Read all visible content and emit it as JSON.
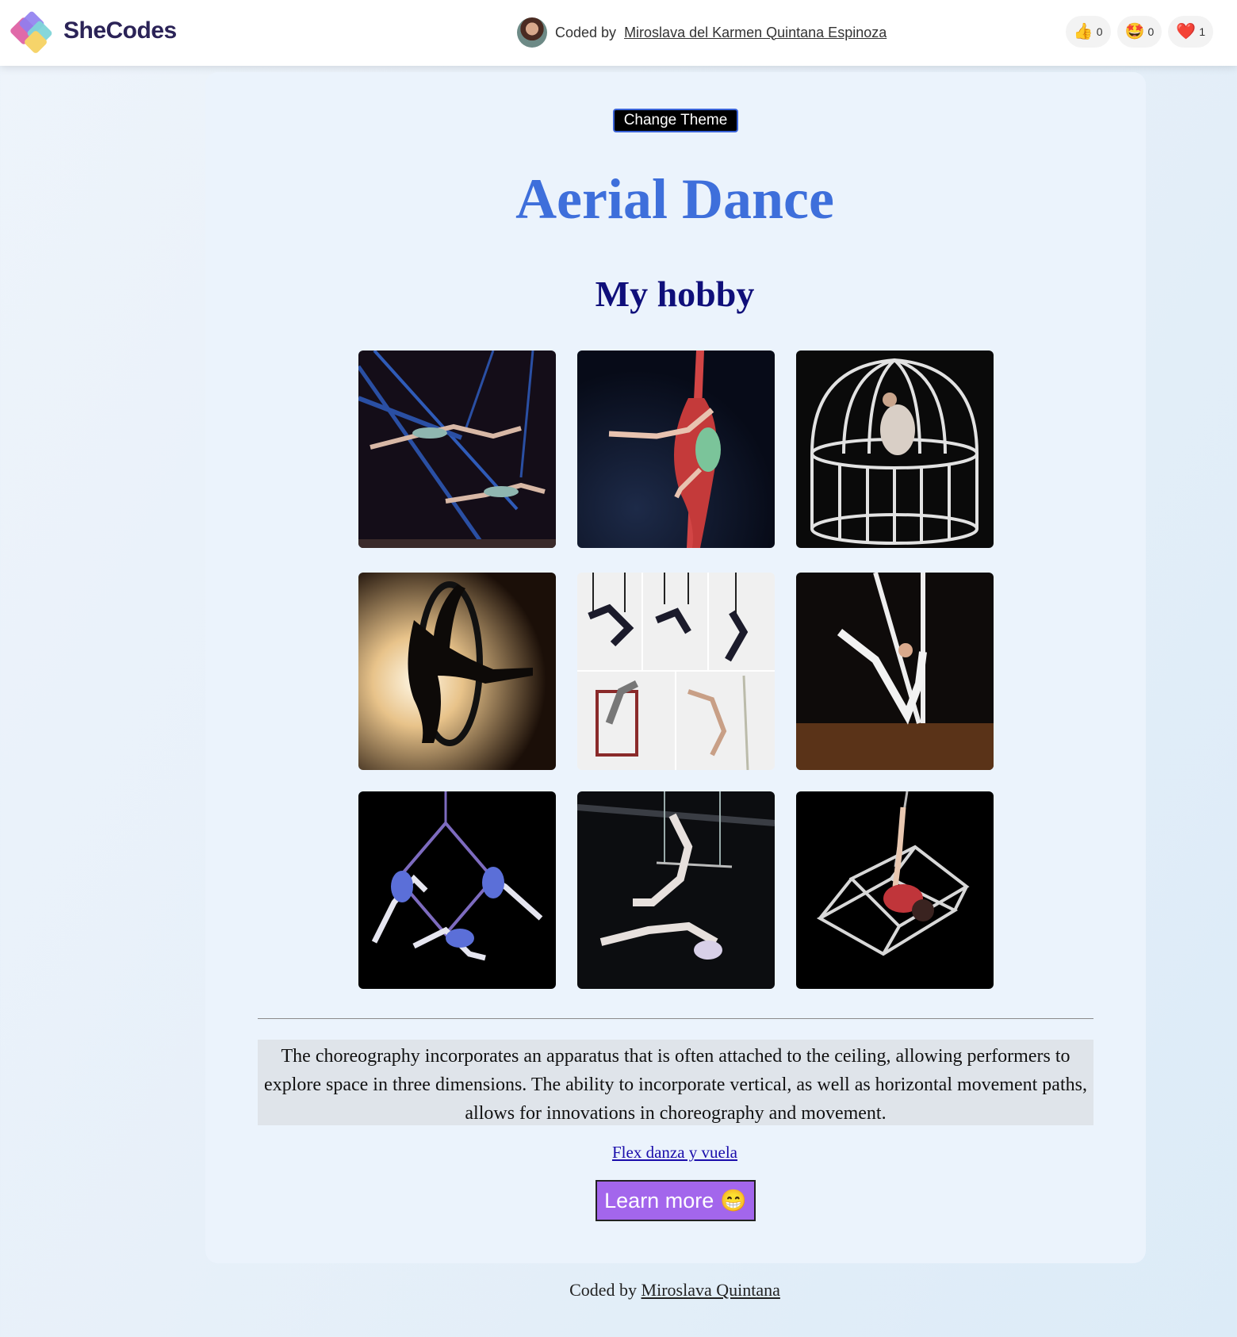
{
  "topbar": {
    "brand": "SheCodes",
    "author_prefix": "Coded by",
    "author_name": "Miroslava del Karmen Quintana Espinoza",
    "reactions": [
      {
        "icon": "thumbs-up-icon",
        "emoji": "👍",
        "count": "0"
      },
      {
        "icon": "star-struck-icon",
        "emoji": "🤩",
        "count": "0"
      },
      {
        "icon": "heart-icon",
        "emoji": "❤️",
        "count": "1"
      }
    ]
  },
  "main": {
    "theme_button": "Change Theme",
    "title": "Aerial Dance",
    "subtitle": "My hobby",
    "photos": [
      {
        "name": "aerial-silks-duo-photo",
        "icon": "photo-icon"
      },
      {
        "name": "red-silks-photo",
        "icon": "photo-icon"
      },
      {
        "name": "birdcage-photo",
        "icon": "photo-icon"
      },
      {
        "name": "aerial-hoop-silhouette-photo",
        "icon": "photo-icon"
      },
      {
        "name": "trapeze-collage-photo",
        "icon": "photo-icon"
      },
      {
        "name": "white-silks-photo",
        "icon": "photo-icon"
      },
      {
        "name": "trio-apparatus-photo",
        "icon": "photo-icon"
      },
      {
        "name": "trapeze-duo-photo",
        "icon": "photo-icon"
      },
      {
        "name": "cube-apparatus-photo",
        "icon": "photo-icon"
      }
    ],
    "description": "The choreography incorporates an apparatus that is often attached to the ceiling, allowing performers to explore space in three dimensions. The ability to incorporate vertical, as well as horizontal movement paths, allows for innovations in choreography and movement.",
    "link": "Flex danza y vuela",
    "learn_button": "Learn more",
    "learn_emoji": "😁"
  },
  "footer": {
    "prefix": "Coded by",
    "name": "Miroslava Quintana"
  },
  "colors": {
    "title": "#3e6fdb",
    "subtitle": "#0f0f7a",
    "learn_button": "#a366ec",
    "card": "#ebf3fc",
    "description_bg": "#dfe4ea"
  }
}
